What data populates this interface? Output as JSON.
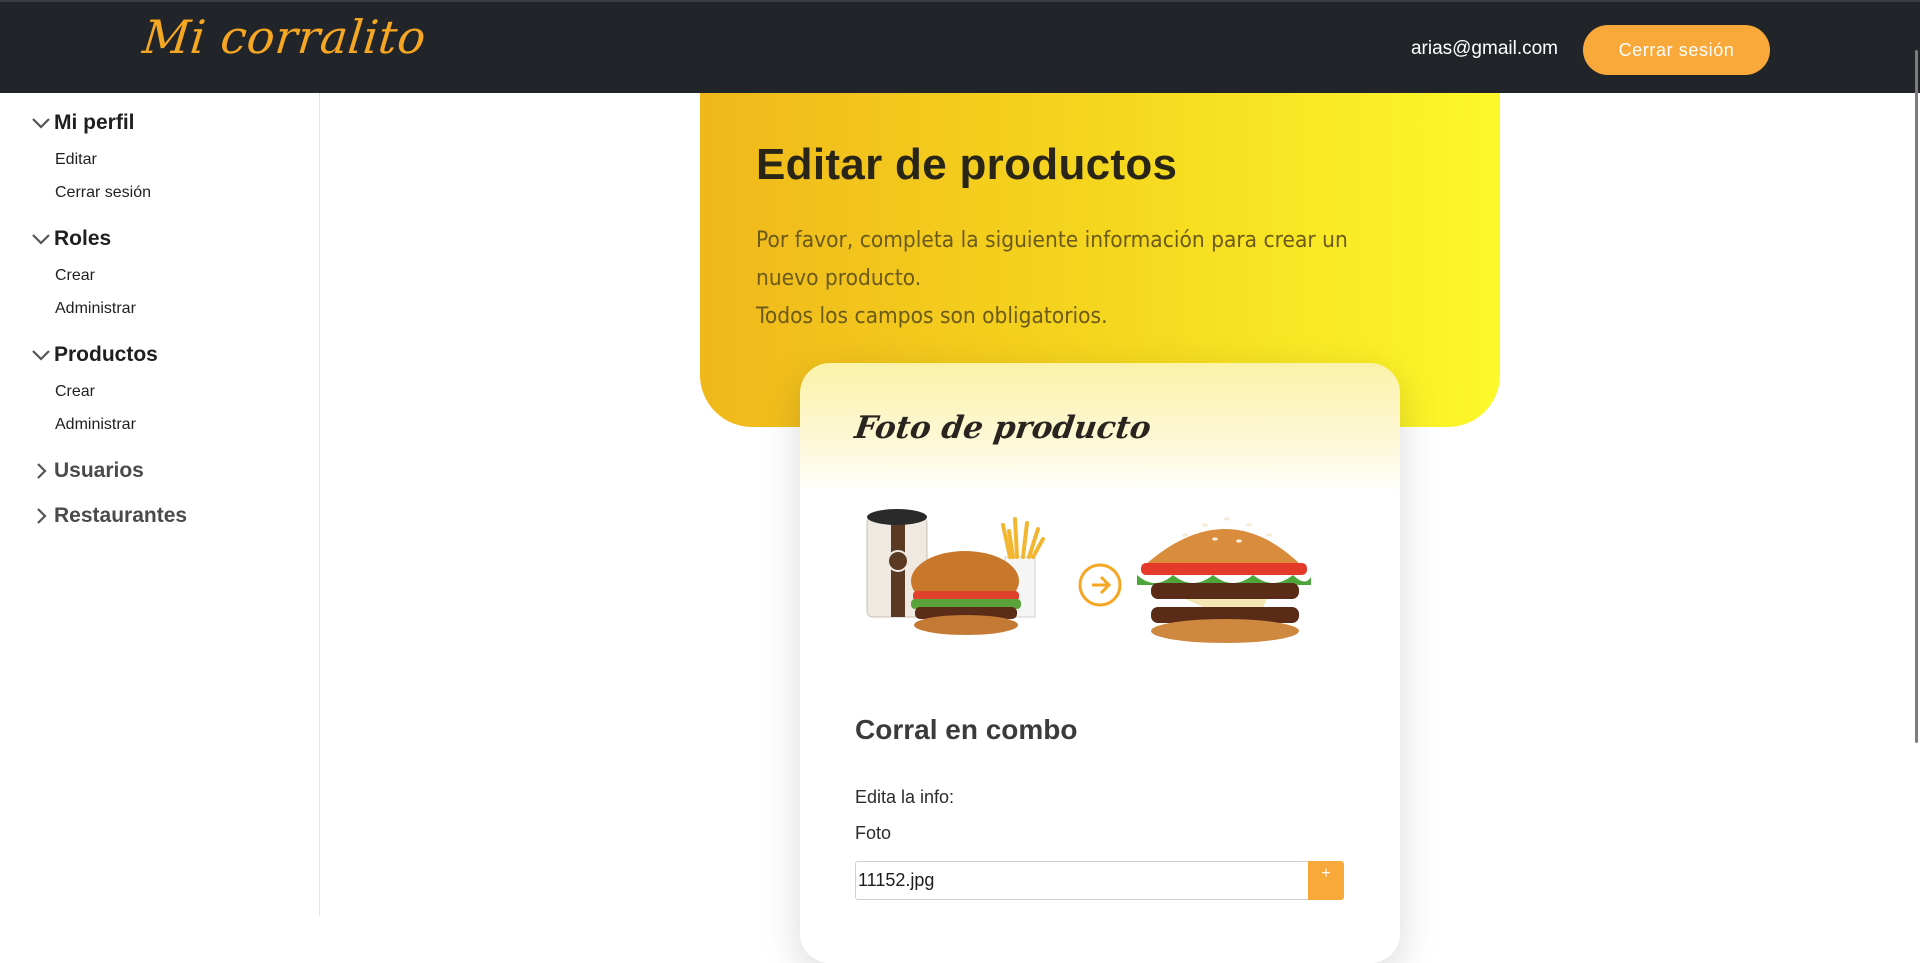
{
  "header": {
    "brand": "Mi corralito",
    "user_email": "arias@gmail.com",
    "logout_label": "Cerrar sesión"
  },
  "sidebar": {
    "groups": [
      {
        "label": "Mi perfil",
        "expanded": true,
        "items": [
          "Editar",
          "Cerrar sesión"
        ]
      },
      {
        "label": "Roles",
        "expanded": true,
        "items": [
          "Crear",
          "Administrar"
        ]
      },
      {
        "label": "Productos",
        "expanded": true,
        "items": [
          "Crear",
          "Administrar"
        ]
      },
      {
        "label": "Usuarios",
        "expanded": false,
        "items": []
      },
      {
        "label": "Restaurantes",
        "expanded": false,
        "items": []
      }
    ]
  },
  "hero": {
    "title": "Editar de productos",
    "subtitle_line1": "Por favor, completa la siguiente información para crear un nuevo producto.",
    "subtitle_line2": "Todos los campos son obligatorios."
  },
  "card": {
    "title": "Foto de producto",
    "product_name": "Corral en combo",
    "edit_label": "Edita la info:",
    "photo_label": "Foto",
    "file_value": "11152.jpg",
    "add_button": "+"
  },
  "colors": {
    "accent": "#f9a93a",
    "header_bg": "#212428",
    "hero_start": "#f0b81b",
    "hero_end": "#fcf92a"
  }
}
